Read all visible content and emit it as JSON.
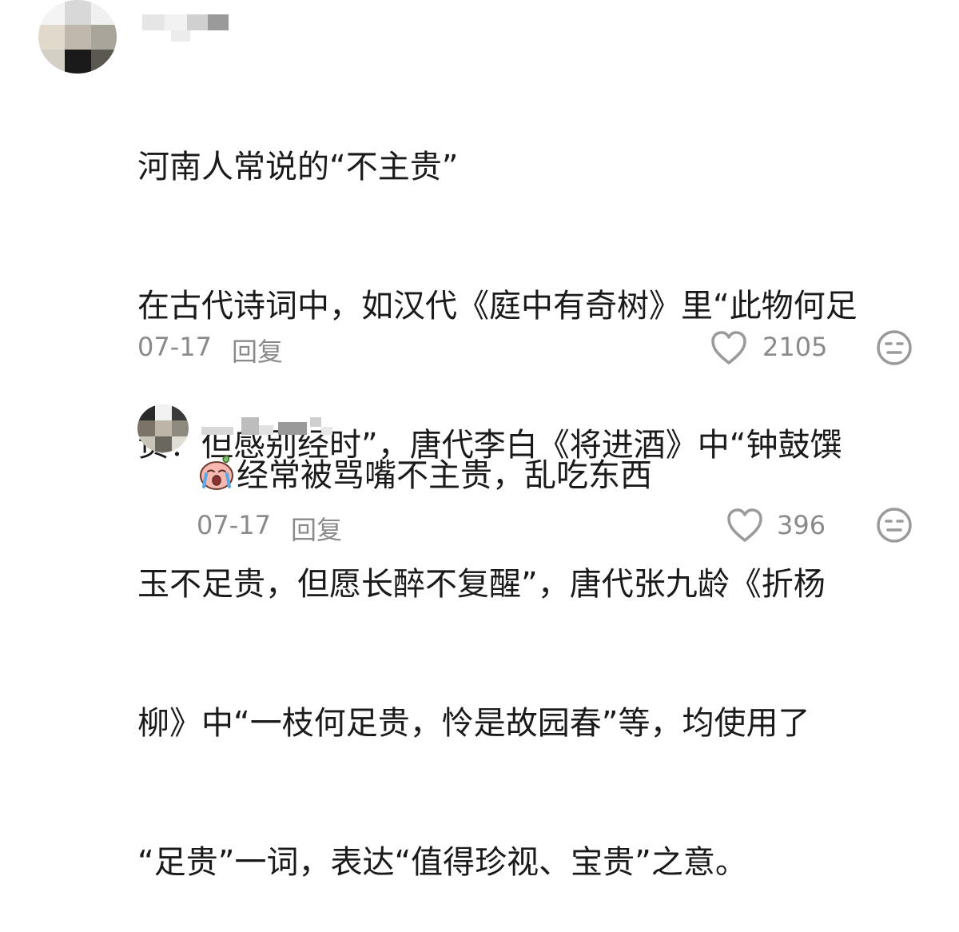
{
  "comment": {
    "lines": [
      "河南人常说的“不主贵”",
      "在古代诗词中，如汉代《庭中有奇树》里“此物何足",
      "贵？但感别经时”，唐代李白《将进酒》中“钟鼓馔",
      "玉不足贵，但愿长醉不复醒”，唐代张九龄《折杨",
      "柳》中“一枝何足贵，怜是故园春”等，均使用了",
      "“足贵”一词，表达“值得珍视、宝贵”之意。"
    ],
    "date": "07-17",
    "reply_label": "回复",
    "like_count": "2105"
  },
  "reply": {
    "text": "经常被骂嘴不主贵，乱吃东西",
    "date": "07-17",
    "reply_label": "回复",
    "like_count": "396"
  },
  "icons": {
    "heart": "heart-outline-icon",
    "dislike": "meh-face-icon"
  },
  "colors": {
    "text": "#1a1a1a",
    "meta": "#8a8a8a",
    "icon": "#9a9a9a"
  }
}
